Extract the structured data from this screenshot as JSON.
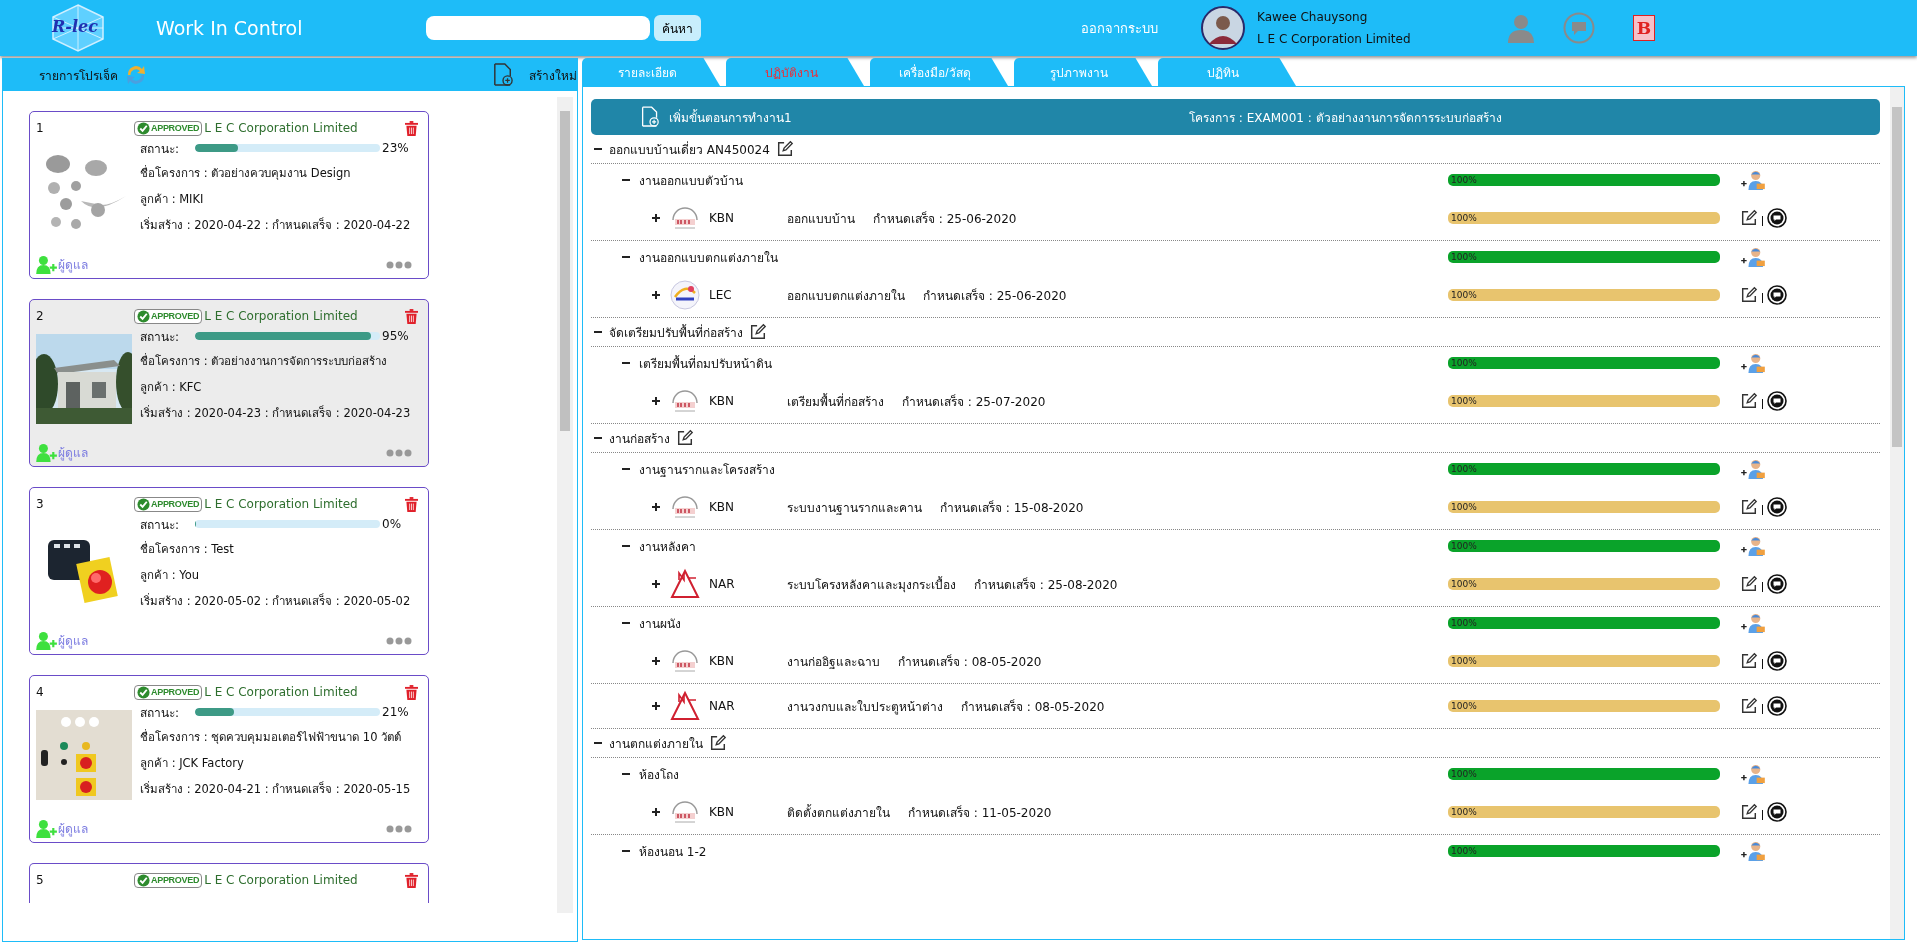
{
  "header": {
    "logo_text": "R-lec",
    "title": "Work In Control",
    "search": {
      "button": "ค้นหา"
    },
    "logout": "ออกจากระบบ",
    "user": {
      "name": "Kawee Chauysong",
      "company": "L E C Corporation Limited"
    },
    "app_badge": "B"
  },
  "project_list": {
    "title": "รายการโปรเจ็ค",
    "create_label": "สร้างใหม่",
    "cards": [
      {
        "number": "1",
        "badge": "APPROVED",
        "company": "L E C Corporation Limited",
        "status_label": "สถานะ:",
        "supervisor_label": "ผู้ดูแล",
        "level": 0.23,
        "percent": "23%",
        "name": "ชื่อโครงการ : ตัวอย่างควบคุมงาน Design",
        "customer": "ลูกค้า : MIKI",
        "dates": "เริ่มสร้าง : 2020-04-22 : กำหนดเสร็จ : 2020-04-22",
        "selected": false
      },
      {
        "number": "2",
        "badge": "APPROVED",
        "company": "L E C Corporation Limited",
        "status_label": "สถานะ:",
        "supervisor_label": "ผู้ดูแล",
        "level": 0.95,
        "percent": "95%",
        "name": "ชื่อโครงการ : ตัวอย่างงานการจัดการระบบก่อสร้าง",
        "customer": "ลูกค้า : KFC",
        "dates": "เริ่มสร้าง : 2020-04-23 : กำหนดเสร็จ : 2020-04-23",
        "selected": true
      },
      {
        "number": "3",
        "badge": "APPROVED",
        "company": "L E C Corporation Limited",
        "status_label": "สถานะ:",
        "supervisor_label": "ผู้ดูแล",
        "level": 0,
        "percent": "0%",
        "name": "ชื่อโครงการ : Test",
        "customer": "ลูกค้า : You",
        "dates": "เริ่มสร้าง : 2020-05-02 : กำหนดเสร็จ : 2020-05-02",
        "selected": false
      },
      {
        "number": "4",
        "badge": "APPROVED",
        "company": "L E C Corporation Limited",
        "status_label": "สถานะ:",
        "supervisor_label": "ผู้ดูแล",
        "level": 0.21,
        "percent": "21%",
        "name": "ชื่อโครงการ : ชุดควบคุมมอเตอร์ไฟฟ้าขนาด 10 วัตต์",
        "customer": "ลูกค้า : JCK Factory",
        "dates": "เริ่มสร้าง : 2020-04-21 : กำหนดเสร็จ : 2020-05-15",
        "selected": false
      },
      {
        "number": "5",
        "badge": "APPROVED",
        "company": "L E C Corporation Limited",
        "selected": false
      }
    ]
  },
  "tabs": [
    {
      "label": "รายละเอียด",
      "selected": false
    },
    {
      "label": "ปฏิบัติงาน",
      "selected": true
    },
    {
      "label": "เครื่องมือ/วัสดุ",
      "selected": false
    },
    {
      "label": "รูปภาพงาน",
      "selected": false
    },
    {
      "label": "ปฏิทิน",
      "selected": false
    }
  ],
  "workflow": {
    "add_step": "เพิ่มขั้นตอนการทำงาน1",
    "project": "โครงการ : EXAM001 : ตัวอย่างงานการจัดการระบบก่อสร้าง",
    "sections": [
      {
        "title": "ออกแบบบ้านเดี่ยว AN450024",
        "expanded": true,
        "children": [
          {
            "title": "งานออกแบบตัวบ้าน",
            "expanded": true,
            "level": 1,
            "reading": "100%",
            "children": [
              {
                "kind": "kbn",
                "company": "KBN",
                "task": "ออกแบบบ้าน",
                "due": "กำหนดเสร็จ : 25-06-2020",
                "expanded": false,
                "level": 1,
                "reading": "100%"
              }
            ]
          },
          {
            "title": "งานออกแบบตกแต่งภายใน",
            "expanded": true,
            "level": 1,
            "reading": "100%",
            "children": [
              {
                "kind": "lec",
                "company": "LEC",
                "task": "ออกแบบตกแต่งภายใน",
                "due": "กำหนดเสร็จ : 25-06-2020",
                "expanded": false,
                "level": 1,
                "reading": "100%"
              }
            ]
          }
        ]
      },
      {
        "title": "จัดเตรียมปรับพื้นที่ก่อสร้าง",
        "expanded": true,
        "children": [
          {
            "title": "เตรียมพื้นที่ถมปรับหน้าดิน",
            "expanded": true,
            "level": 1,
            "reading": "100%",
            "children": [
              {
                "kind": "kbn",
                "company": "KBN",
                "task": "เตรียมพื้นที่ก่อสร้าง",
                "due": "กำหนดเสร็จ : 25-07-2020",
                "expanded": false,
                "level": 1,
                "reading": "100%"
              }
            ]
          }
        ]
      },
      {
        "title": "งานก่อสร้าง",
        "expanded": true,
        "children": [
          {
            "title": "งานฐานรากและโครงสร้าง",
            "expanded": true,
            "level": 1,
            "reading": "100%",
            "children": [
              {
                "kind": "kbn",
                "company": "KBN",
                "task": "ระบบงานฐานรากและคาน",
                "due": "กำหนดเสร็จ : 15-08-2020",
                "expanded": false,
                "level": 1,
                "reading": "100%"
              }
            ]
          },
          {
            "title": "งานหลังคา",
            "expanded": true,
            "level": 1,
            "reading": "100%",
            "children": [
              {
                "kind": "nar",
                "company": "NAR",
                "task": "ระบบโครงหลังคาและมุงกระเบื้อง",
                "due": "กำหนดเสร็จ : 25-08-2020",
                "expanded": false,
                "level": 1,
                "reading": "100%"
              }
            ]
          },
          {
            "title": "งานผนัง",
            "expanded": true,
            "level": 1,
            "reading": "100%",
            "children": [
              {
                "kind": "kbn",
                "company": "KBN",
                "task": "งานก่ออิฐและฉาบ",
                "due": "กำหนดเสร็จ : 08-05-2020",
                "expanded": false,
                "level": 1,
                "reading": "100%"
              },
              {
                "kind": "nar",
                "company": "NAR",
                "task": "งานวงกบและใบประตูหน้าต่าง",
                "due": "กำหนดเสร็จ : 08-05-2020",
                "expanded": false,
                "level": 1,
                "reading": "100%"
              }
            ]
          }
        ]
      },
      {
        "title": "งานตกแต่งภายใน",
        "expanded": true,
        "children": [
          {
            "title": "ห้องโถง",
            "expanded": true,
            "level": 1,
            "reading": "100%",
            "children": [
              {
                "kind": "kbn",
                "company": "KBN",
                "task": "ติดตั้งตกแต่งภายใน",
                "due": "กำหนดเสร็จ : 11-05-2020",
                "expanded": false,
                "level": 1,
                "reading": "100%"
              }
            ]
          },
          {
            "title": "ห้องนอน 1-2",
            "expanded": true,
            "level": 1,
            "reading": "100%"
          }
        ]
      }
    ]
  }
}
